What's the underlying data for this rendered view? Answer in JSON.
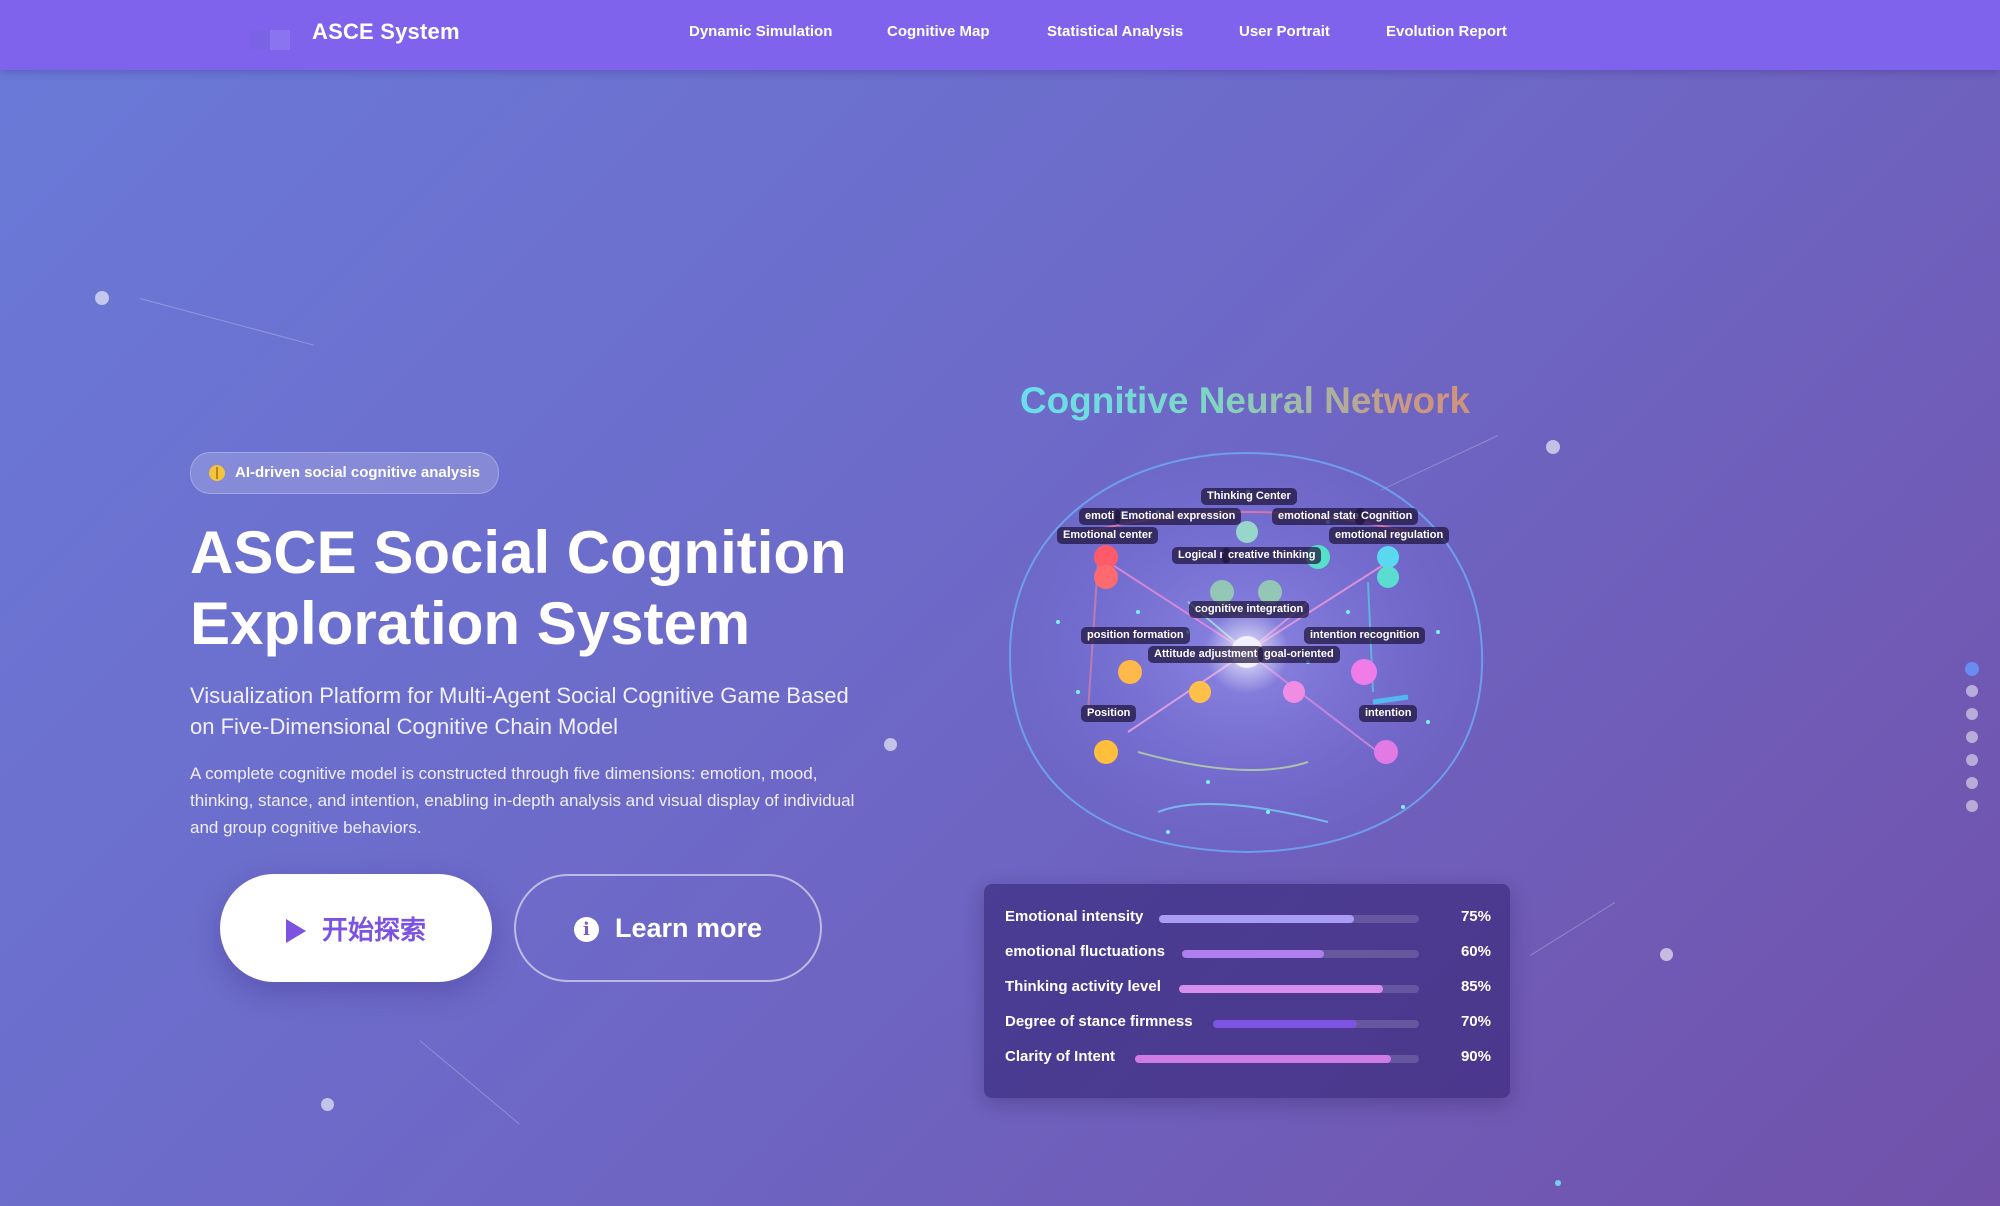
{
  "header": {
    "brand": "ASCE System",
    "nav": [
      "Dynamic Simulation",
      "Cognitive Map",
      "Statistical Analysis",
      "User Portrait",
      "Evolution Report"
    ]
  },
  "hero": {
    "badge": "AI-driven social cognitive analysis",
    "title_line1": "ASCE Social Cognition",
    "title_line2": "Exploration System",
    "subtitle": "Visualization Platform for Multi-Agent Social Cognitive Game Based on Five-Dimensional Cognitive Chain Model",
    "description": "A complete cognitive model is constructed through five dimensions: emotion, mood, thinking, stance, and intention, enabling in-depth analysis and visual display of individual and group cognitive behaviors.",
    "primary_button": "开始探索",
    "secondary_button": "Learn more"
  },
  "network": {
    "title": "Cognitive Neural Network",
    "labels": [
      "Thinking Center",
      "emoti",
      "Emotional expression",
      "emotional state",
      "Cognition",
      "Emotional center",
      "emotional regulation",
      "Logical r",
      "creative thinking",
      "cognitive integration",
      "position formation",
      "intention recognition",
      "Attitude adjustment",
      "goal-oriented",
      "Position",
      "intention"
    ]
  },
  "metrics": [
    {
      "label": "Emotional intensity",
      "value": 75,
      "display": "75%",
      "color": "#a99cf5"
    },
    {
      "label": "emotional fluctuations",
      "value": 60,
      "display": "60%",
      "color": "#b07fee"
    },
    {
      "label": "Thinking activity level",
      "value": 85,
      "display": "85%",
      "color": "#d58fea"
    },
    {
      "label": "Degree of stance firmness",
      "value": 70,
      "display": "70%",
      "color": "#7d55e2"
    },
    {
      "label": "Clarity of Intent",
      "value": 90,
      "display": "90%",
      "color": "#cf7be6"
    }
  ],
  "pager": {
    "count": 7,
    "active": 0
  }
}
